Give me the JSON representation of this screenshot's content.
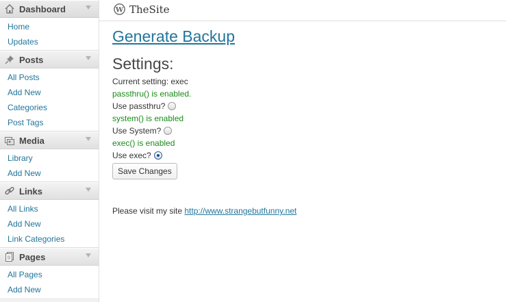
{
  "sidebar": {
    "sections": [
      {
        "title": "Dashboard",
        "icon": "home-icon",
        "items": [
          "Home",
          "Updates"
        ]
      },
      {
        "title": "Posts",
        "icon": "pushpin-icon",
        "items": [
          "All Posts",
          "Add New",
          "Categories",
          "Post Tags"
        ]
      },
      {
        "title": "Media",
        "icon": "media-icon",
        "items": [
          "Library",
          "Add New"
        ]
      },
      {
        "title": "Links",
        "icon": "chain-link-icon",
        "items": [
          "All Links",
          "Add New",
          "Link Categories"
        ]
      },
      {
        "title": "Pages",
        "icon": "pages-icon",
        "items": [
          "All Pages",
          "Add New"
        ]
      }
    ]
  },
  "header": {
    "site_title": "TheSite",
    "logo": "wordpress-logo-icon"
  },
  "main": {
    "backup_link": "Generate Backup",
    "settings_title": "Settings:",
    "current_setting": "Current setting: exec",
    "passthru_status": "passthru() is enabled.",
    "passthru_option": "Use passthru?",
    "system_status": "system() is enabled",
    "system_option": "Use System?",
    "exec_status": "exec() is enabled",
    "exec_option": "Use exec?",
    "selected_option": "exec",
    "save_button": "Save Changes",
    "visit_text": "Please visit my site",
    "visit_link": "http://www.strangebutfunny.net"
  },
  "colors": {
    "link": "#21759b",
    "enabled": "#1a8a1a",
    "sidebar_bg": "#f1f1f1"
  }
}
